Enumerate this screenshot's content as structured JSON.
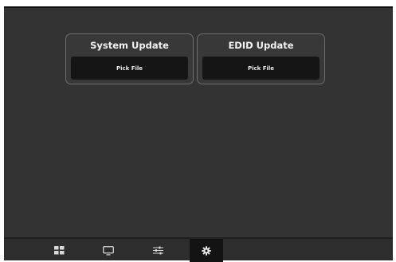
{
  "cards": [
    {
      "title": "System Update",
      "button_label": "Pick File"
    },
    {
      "title": "EDID Update",
      "button_label": "Pick File"
    }
  ],
  "nav": {
    "items": [
      {
        "icon": "grid-icon",
        "active": false
      },
      {
        "icon": "monitor-icon",
        "active": false
      },
      {
        "icon": "sliders-icon",
        "active": false
      },
      {
        "icon": "gear-icon",
        "active": true
      }
    ]
  },
  "colors": {
    "background": "#333333",
    "card_border": "#6e6e6e",
    "button_bg": "#151515",
    "nav_bg": "#2d2d2d",
    "nav_active_bg": "#131313",
    "icon": "#d8d8d8"
  }
}
